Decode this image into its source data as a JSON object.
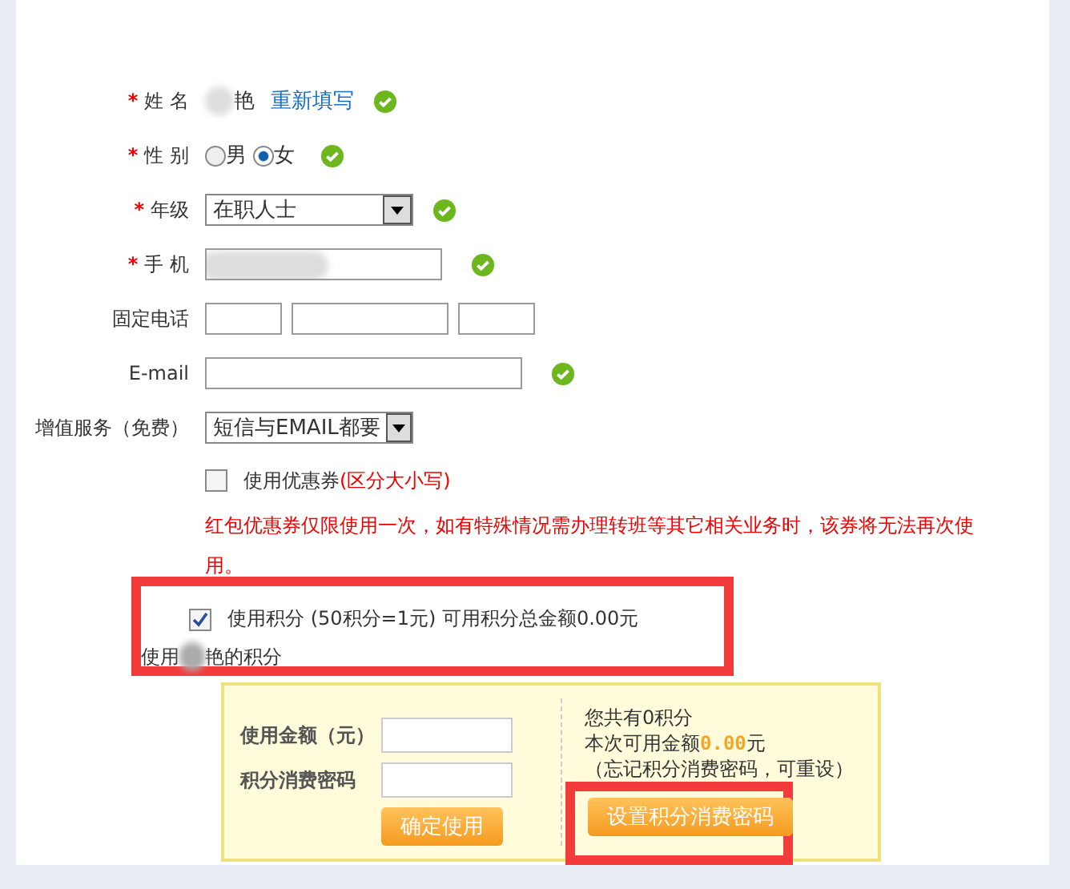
{
  "form": {
    "rows": [
      {
        "kind": "name",
        "label": "姓 名",
        "marker": "*",
        "value": "艳",
        "link": "重新填写",
        "valid": true
      },
      {
        "kind": "radio",
        "label": "性 别",
        "marker": "*",
        "options": [
          {
            "label": "男",
            "selected": false
          },
          {
            "label": "女",
            "selected": true
          }
        ],
        "valid": true
      },
      {
        "kind": "select",
        "label": "年级",
        "marker": "*",
        "value": "在职人士",
        "valid": true
      },
      {
        "kind": "mobile",
        "label": "手 机",
        "marker": "*",
        "valid": true
      },
      {
        "kind": "phone",
        "label": "固定电话",
        "valid": false
      },
      {
        "kind": "input",
        "label": "E-mail",
        "valid": true
      },
      {
        "kind": "select",
        "label": "增值服务（免费）",
        "value": "短信与EMAIL都要",
        "valid": false
      }
    ]
  },
  "coupon": {
    "checked": false,
    "label": "使用优惠券",
    "note": "(区分大小写)",
    "warning": "红包优惠券仅限使用一次，如有特殊情况需办理转班等其它相关业务时，该券将无法再次使用。"
  },
  "points": {
    "checked": true,
    "highlighted": true,
    "label": "使用积分 (50积分=1元) 可用积分总金额0.00元",
    "user_prefix": "使用",
    "user_suffix": "艳的积分"
  },
  "panel": {
    "fields": [
      {
        "label": "使用金额（元）"
      },
      {
        "label": "积分消费密码"
      }
    ],
    "confirm_button": "确定使用",
    "total": "您共有0积分",
    "available_label": "本次可用金额",
    "available_amount": "0.00",
    "available_unit": "元",
    "hint": "（忘记积分消费密码，可重设）",
    "set_password_button": "设置积分消费密码",
    "set_password_highlighted": true
  }
}
